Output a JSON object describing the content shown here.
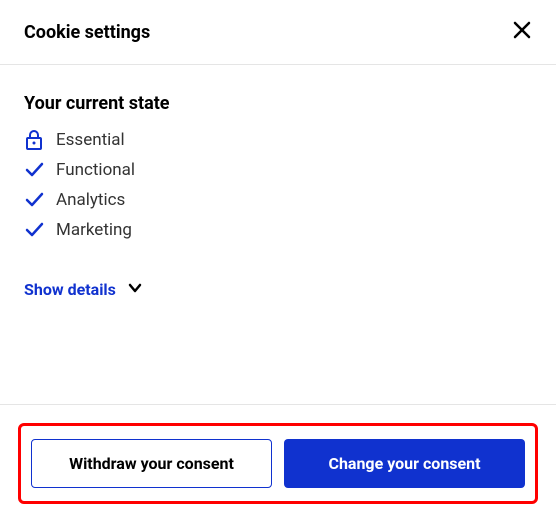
{
  "header": {
    "title": "Cookie settings"
  },
  "section": {
    "title": "Your current state"
  },
  "categories": [
    {
      "label": "Essential"
    },
    {
      "label": "Functional"
    },
    {
      "label": "Analytics"
    },
    {
      "label": "Marketing"
    }
  ],
  "show_details": {
    "label": "Show details"
  },
  "buttons": {
    "withdraw": "Withdraw your consent",
    "change": "Change your consent"
  },
  "colors": {
    "primary": "#1032cf",
    "highlight_border": "#ff0000"
  }
}
